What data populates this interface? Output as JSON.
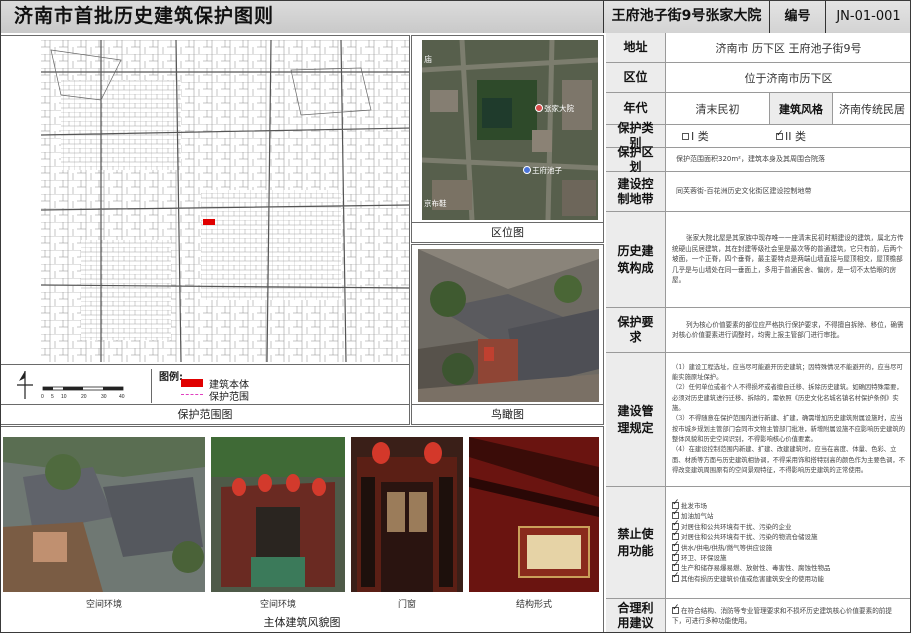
{
  "header": {
    "title": "济南市首批历史建筑保护图则",
    "building_name": "王府池子街9号张家大院",
    "code_label": "编号",
    "code_value": "JN-01-001"
  },
  "map_panel": {
    "caption": "保护范围图",
    "legend_title": "图例:",
    "legend_items": [
      {
        "label": "建筑本体",
        "color": "#e00000"
      },
      {
        "label": "保护范围",
        "color": "#e040c0"
      }
    ],
    "scale_ticks": [
      "0",
      "5",
      "10",
      "20",
      "30",
      "40"
    ]
  },
  "location_panel": {
    "caption": "区位图",
    "labels": {
      "top_left": "庙",
      "pin1": "张家大院",
      "pin2": "王府池子",
      "bottom_left": "京布鞋"
    }
  },
  "aerial_panel": {
    "caption": "鸟瞰图"
  },
  "photos": {
    "caption": "主体建筑风貌图",
    "items": [
      "空间环境",
      "空间环境",
      "门窗",
      "结构形式"
    ]
  },
  "info": {
    "address_label": "地址",
    "address_value": "济南市 历下区 王府池子街9号",
    "district_label": "区位",
    "district_value": "位于济南市历下区",
    "era_label": "年代",
    "era_value": "清末民初",
    "style_label": "建筑风格",
    "style_value": "济南传统民居",
    "category_label": "保护类别",
    "category_options": [
      {
        "label": "I 类",
        "checked": false
      },
      {
        "label": "II 类",
        "checked": true
      }
    ],
    "zone_label": "保护区划",
    "zone_value": "保护范围面积320m²，建筑本身及其周围合院落",
    "control_label": "建设控制地带",
    "control_value": "同芙蓉街-百花洲历史文化街区建设控制地带",
    "history_label": "历史建筑构成",
    "history_text": "张家大院北屋是其家族中现存唯一一座清末民初时期建设的建筑，属北方传统硬山民居建筑，其在封建等级社会里是最次等的普通建筑，它只有前，后两个坡面，一个正脊，四个垂脊，最主要特点是两端山墙直接与屋顶相交，屋顶檐部几乎是与山墙处在同一垂面上，多用于普通民舍、偏房，是一切不太恰眼的房屋。",
    "requirement_label": "保护要求",
    "requirement_text": "列为核心价值要素的部位应严格执行保护要求，不得擅自拆除、移位，确需对核心价值要素进行调整时，均需上报主管部门进行审批。",
    "management_label": "建设管理规定",
    "management_items": [
      "（1）建设工程选址，应当尽可能避开历史建筑；因特殊情况不能避开的，应当尽可能实施原址保护。",
      "（2）任何单位或者个人不得损坏或者擅自迁移、拆除历史建筑。如确因特殊需要，必须对历史建筑进行迁移、拆除的，需依照《历史文化名城名镇名村保护条例》实施。",
      "（3）不得随意在保护范围内进行新建、扩建，确需增加历史建筑附属设施时，应当按市城乡规划主管部门会同市文物主管部门批准，新增附属设施不应影响历史建筑的整体风貌和历史空间识别，不得影响核心价值要素。",
      "（4）在建设控制范围内新建、扩建、改建建筑时，应当在高度、体量、色彩、立面、材质等方面与历史建筑相协调，不得采用饰和搭特别高的颜色作为主要色调，不得改变建筑周围原有的空间景观特征，不得影响历史建筑的正常使用。"
    ],
    "prohibit_label": "禁止使用功能",
    "prohibit_items": [
      "批发市场",
      "加油加气站",
      "对居住和公共环境有干扰、污染的企业",
      "对居住和公共环境有干扰、污染的物流仓储设施",
      "供水/供电/供热/燃气等供应设施",
      "环卫、环保设施",
      "生产和储存易爆易燃、放射性、毒害性、腐蚀性物品",
      "其他有损历史建筑价值或危害建筑安全的使用功能"
    ],
    "reuse_label": "合理利用建议",
    "reuse_text": "在符合结构、消防等专业管理要求和不损坏历史建筑核心价值要素的前提下，可进行多种功能使用。"
  }
}
